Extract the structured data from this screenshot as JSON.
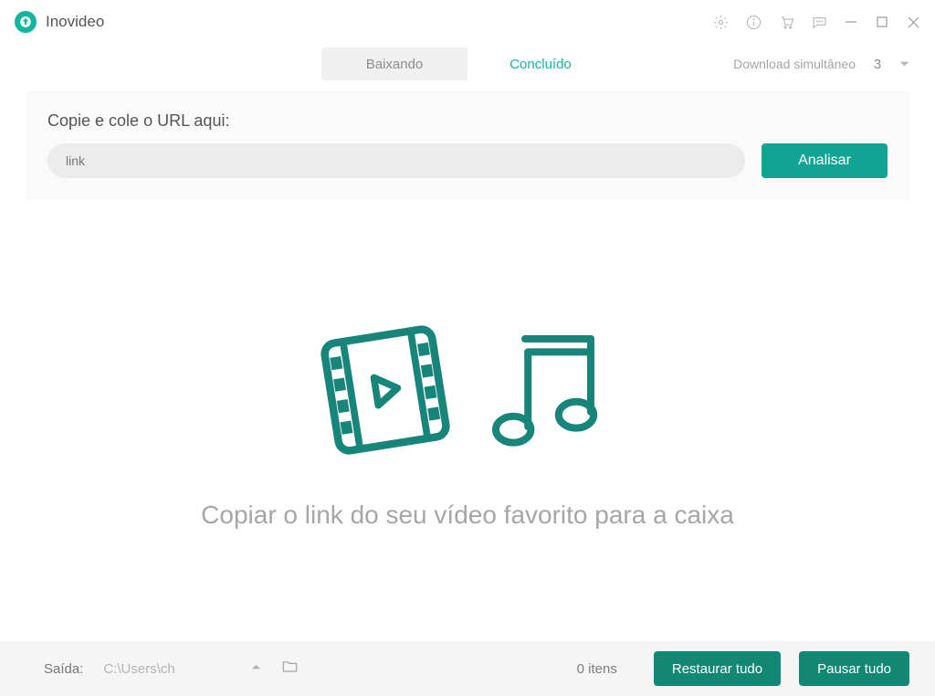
{
  "app": {
    "title": "Inovideo"
  },
  "tabs": {
    "downloading": "Baixando",
    "done": "Concluído",
    "active": "done"
  },
  "simultaneous": {
    "label": "Download simultâneo",
    "value": "3"
  },
  "url_section": {
    "label": "Copie e cole o URL aqui:",
    "placeholder": "link",
    "analyze": "Analisar"
  },
  "empty": {
    "message": "Copiar o link do seu vídeo favorito para a caixa"
  },
  "footer": {
    "output_label": "Saída:",
    "output_path": "C:\\Users\\ch",
    "item_count": "0 itens",
    "restore_all": "Restaurar tudo",
    "pause_all": "Pausar tudo"
  },
  "colors": {
    "accent": "#12b5a0",
    "accent_dark": "#118774"
  }
}
